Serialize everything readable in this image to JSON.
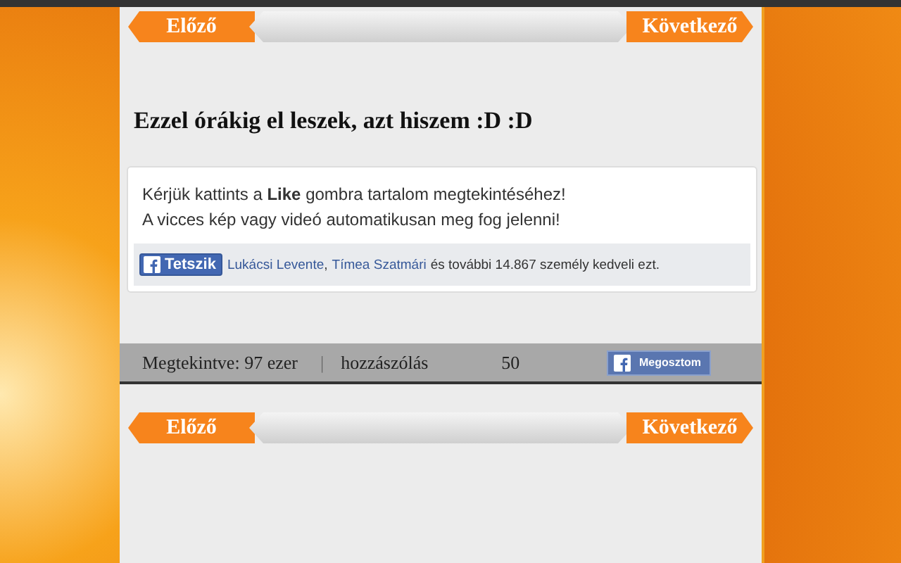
{
  "nav_top": {
    "prev": "Előző",
    "next": "Következő"
  },
  "post": {
    "title": "Ezzel órákig el leszek, azt hiszem :D :D"
  },
  "like_box": {
    "message": "Kérjük kattints a **Like** gombra tartalom megtekintéséhez!",
    "message_2": "A vicces kép vagy videó automatikusan meg fog jelenni!",
    "like_button": "Tetszik",
    "friend_1": "Lukácsi Levente",
    "separator": ",",
    "friend_2": "Tímea Szatmári",
    "likes_text": "és további 14.867 személy kedveli ezt."
  },
  "stats": {
    "views": "Megtekintve: 97 ezer",
    "divider": "|",
    "comments_label": "hozzászólás",
    "comments_count": "50",
    "share_button": "Megosztom"
  },
  "nav_bottom": {
    "prev": "Előző",
    "next": "Következő"
  }
}
